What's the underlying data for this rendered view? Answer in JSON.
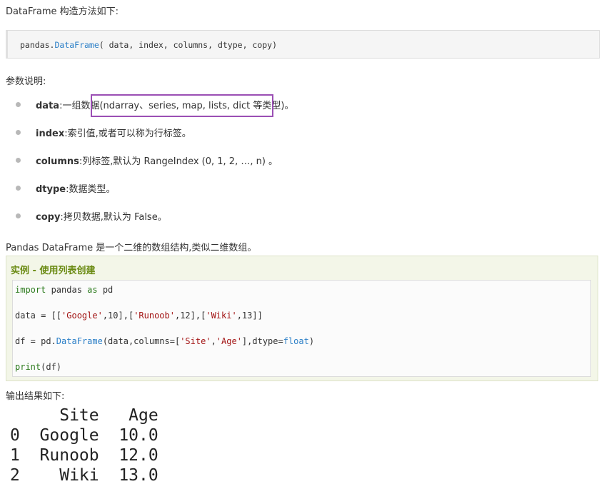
{
  "intro_text": "DataFrame 构造方法如下:",
  "constructor": {
    "prefix": "pandas.",
    "fn": "DataFrame",
    "args": "( data, index, columns, dtype, copy)"
  },
  "params_title": "参数说明:",
  "params": [
    {
      "name": "data",
      "desc": ":一组数据(ndarray、series, map, lists, dict 等类型)。"
    },
    {
      "name": "index",
      "desc": ":索引值,或者可以称为行标签。"
    },
    {
      "name": "columns",
      "desc": ":列标签,默认为 RangeIndex (0, 1, 2, …, n) 。"
    },
    {
      "name": "dtype",
      "desc": ":数据类型。"
    },
    {
      "name": "copy",
      "desc": ":拷贝数据,默认为 False。"
    }
  ],
  "description": "Pandas DataFrame 是一个二维的数组结构,类似二维数组。",
  "example": {
    "title": "实例 - 使用列表创建",
    "line1": {
      "kw": "import",
      "mid": " pandas ",
      "kw2": "as",
      "end": " pd"
    },
    "line2": {
      "a": "data = [[",
      "s1": "'Google'",
      "b": ",10],[",
      "s2": "'Runoob'",
      "c": ",12],[",
      "s3": "'Wiki'",
      "d": ",13]]"
    },
    "line3": {
      "a": "df = pd.",
      "cls": "DataFrame",
      "b": "(data,columns=[",
      "s1": "'Site'",
      "c": ",",
      "s2": "'Age'",
      "d": "],dtype=",
      "kw": "float",
      "e": ")"
    },
    "line4": {
      "kw": "print",
      "end": "(df)"
    }
  },
  "output_title": "输出结果如下:",
  "output_lines": [
    "     Site   Age",
    "0  Google  10.0",
    "1  Runoob  12.0",
    "2    Wiki  13.0"
  ]
}
